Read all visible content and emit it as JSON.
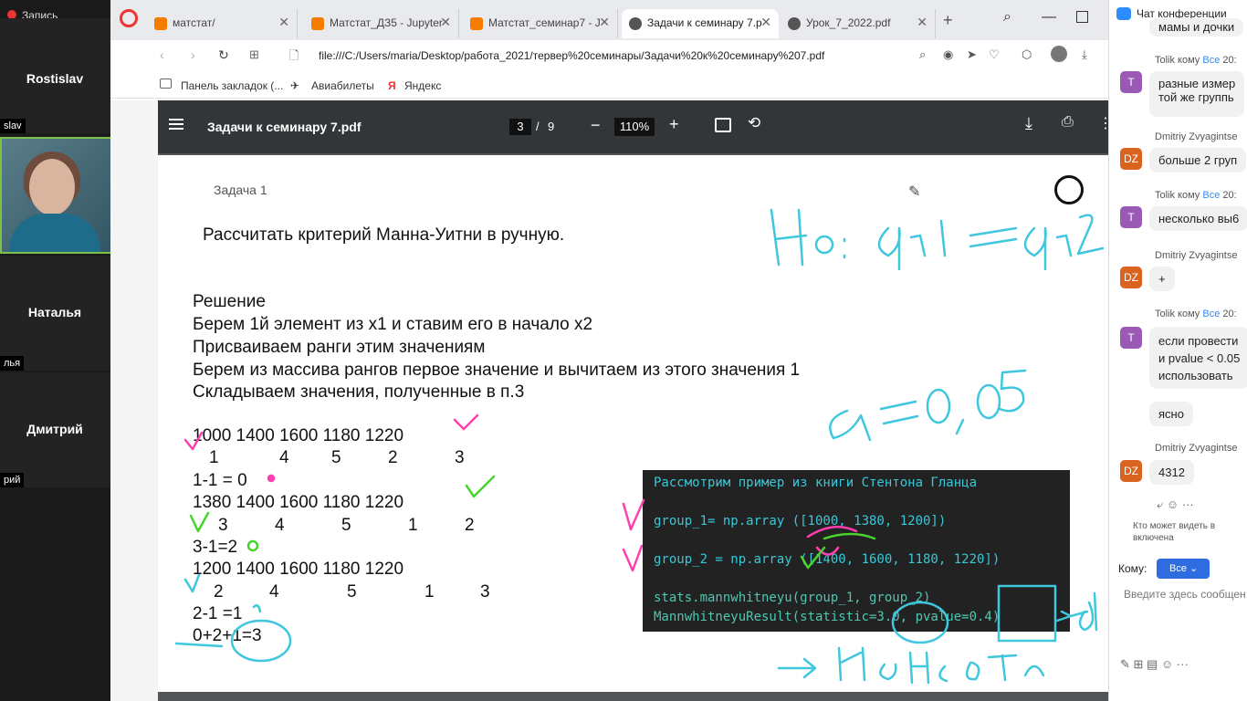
{
  "recording": "Запись",
  "participants": [
    {
      "name": "Rostislav",
      "label": "slav"
    },
    {
      "name": "Наталья",
      "label": "лья"
    },
    {
      "name": "Дмитрий",
      "label": "рий"
    }
  ],
  "tabs": [
    {
      "label": "матстат/"
    },
    {
      "label": "Матстат_ДЗ5 - Jupyter"
    },
    {
      "label": "Матстат_семинар7 - J"
    },
    {
      "label": "Задачи к семинару 7.р"
    },
    {
      "label": "Урок_7_2022.pdf"
    }
  ],
  "url": "file:///C:/Users/maria/Desktop/работа_2021/тервер%20семинары/Задачи%20к%20семинару%207.pdf",
  "bookmarks": [
    "Панель закладок (...",
    "Авиабилеты",
    "Яндекс"
  ],
  "pdf": {
    "title": "Задачи к семинару 7.pdf",
    "page": "3",
    "pages": "9",
    "zoom": "110%"
  },
  "page_content": {
    "task": "Задача 1",
    "heading": "Рассчитать критерий Манна-Уитни в ручную.",
    "solution": [
      "Решение",
      "Берем 1й элемент из x1  и ставим его в начало x2",
      "Присваиваем ранги этим значениям",
      "Берем из массива рангов первое значение и вычитаем из этого значения 1",
      "Складываем значения, полученные в п.3"
    ],
    "calc": [
      {
        "values": "1000  1400  1600  1180  1220",
        "ranks": [
          "1",
          "4",
          "5",
          "2",
          "3"
        ],
        "diff": "1-1 = 0"
      },
      {
        "values": "1380   1400   1600   1180  1220",
        "ranks": [
          "3",
          "4",
          "5",
          "1",
          "2"
        ],
        "diff": "3-1=2"
      },
      {
        "values": "1200   1400    1600    1180   1220",
        "ranks": [
          "2",
          "4",
          "5",
          "1",
          "3"
        ],
        "diff": "2-1 =1"
      }
    ],
    "sum": "0+2+1=3"
  },
  "code": {
    "comment": "Рассмотрим пример из книги Стентона Гланца",
    "line1": "group_1= np.array ([1000, 1380, 1200])",
    "line2": "group_2 = np.array ([1400, 1600, 1180, 1220])",
    "line3": "stats.mannwhitneyu(group_1, group_2)",
    "line4": "MannwhitneyuResult(statistic=3.0, pvalue=0.4)"
  },
  "chat": {
    "title": "Чат конференции",
    "messages": [
      {
        "sender": "",
        "text": "мамы и дочки"
      },
      {
        "sender": "Tolik кому",
        "to": "Все",
        "time": "20:",
        "avatar": "T",
        "text": [
          "разные измер",
          "той же группь"
        ]
      },
      {
        "sender": "Dmitriy Zvyagintse",
        "avatar": "DZ",
        "text": [
          "больше 2 груп"
        ]
      },
      {
        "sender": "Tolik кому",
        "to": "Все",
        "time": "20:",
        "avatar": "T",
        "text": [
          "несколько вы6"
        ]
      },
      {
        "sender": "Dmitriy Zvyagintse",
        "avatar": "DZ",
        "text": [
          "+"
        ]
      },
      {
        "sender": "Tolik кому",
        "to": "Все",
        "time": "20:",
        "avatar": "T",
        "text": [
          "если провести",
          "и pvalue < 0.05",
          "использовать"
        ]
      },
      {
        "sender": "",
        "text": [
          "ясно"
        ]
      },
      {
        "sender": "Dmitriy Zvyagintse",
        "avatar": "DZ",
        "text": [
          "4312"
        ]
      }
    ],
    "visibility": "Кто может видеть в",
    "visibility2": "включена",
    "to_label": "Кому:",
    "to_value": "Все",
    "placeholder": "Введите здесь сообщен"
  },
  "handwriting": {
    "h0": "H0: gr1 = gr2",
    "alpha": "α = 0,05",
    "bottom": "H0 не отв"
  }
}
